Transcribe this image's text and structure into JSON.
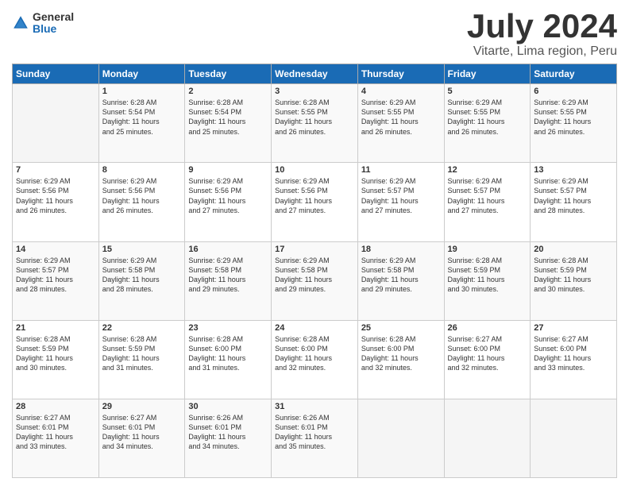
{
  "header": {
    "logo": {
      "line1": "General",
      "line2": "Blue"
    },
    "title": "July 2024",
    "subtitle": "Vitarte, Lima region, Peru"
  },
  "days_of_week": [
    "Sunday",
    "Monday",
    "Tuesday",
    "Wednesday",
    "Thursday",
    "Friday",
    "Saturday"
  ],
  "weeks": [
    [
      {
        "day": "",
        "info": ""
      },
      {
        "day": "1",
        "info": "Sunrise: 6:28 AM\nSunset: 5:54 PM\nDaylight: 11 hours\nand 25 minutes."
      },
      {
        "day": "2",
        "info": "Sunrise: 6:28 AM\nSunset: 5:54 PM\nDaylight: 11 hours\nand 25 minutes."
      },
      {
        "day": "3",
        "info": "Sunrise: 6:28 AM\nSunset: 5:55 PM\nDaylight: 11 hours\nand 26 minutes."
      },
      {
        "day": "4",
        "info": "Sunrise: 6:29 AM\nSunset: 5:55 PM\nDaylight: 11 hours\nand 26 minutes."
      },
      {
        "day": "5",
        "info": "Sunrise: 6:29 AM\nSunset: 5:55 PM\nDaylight: 11 hours\nand 26 minutes."
      },
      {
        "day": "6",
        "info": "Sunrise: 6:29 AM\nSunset: 5:55 PM\nDaylight: 11 hours\nand 26 minutes."
      }
    ],
    [
      {
        "day": "7",
        "info": "Sunrise: 6:29 AM\nSunset: 5:56 PM\nDaylight: 11 hours\nand 26 minutes."
      },
      {
        "day": "8",
        "info": "Sunrise: 6:29 AM\nSunset: 5:56 PM\nDaylight: 11 hours\nand 26 minutes."
      },
      {
        "day": "9",
        "info": "Sunrise: 6:29 AM\nSunset: 5:56 PM\nDaylight: 11 hours\nand 27 minutes."
      },
      {
        "day": "10",
        "info": "Sunrise: 6:29 AM\nSunset: 5:56 PM\nDaylight: 11 hours\nand 27 minutes."
      },
      {
        "day": "11",
        "info": "Sunrise: 6:29 AM\nSunset: 5:57 PM\nDaylight: 11 hours\nand 27 minutes."
      },
      {
        "day": "12",
        "info": "Sunrise: 6:29 AM\nSunset: 5:57 PM\nDaylight: 11 hours\nand 27 minutes."
      },
      {
        "day": "13",
        "info": "Sunrise: 6:29 AM\nSunset: 5:57 PM\nDaylight: 11 hours\nand 28 minutes."
      }
    ],
    [
      {
        "day": "14",
        "info": "Sunrise: 6:29 AM\nSunset: 5:57 PM\nDaylight: 11 hours\nand 28 minutes."
      },
      {
        "day": "15",
        "info": "Sunrise: 6:29 AM\nSunset: 5:58 PM\nDaylight: 11 hours\nand 28 minutes."
      },
      {
        "day": "16",
        "info": "Sunrise: 6:29 AM\nSunset: 5:58 PM\nDaylight: 11 hours\nand 29 minutes."
      },
      {
        "day": "17",
        "info": "Sunrise: 6:29 AM\nSunset: 5:58 PM\nDaylight: 11 hours\nand 29 minutes."
      },
      {
        "day": "18",
        "info": "Sunrise: 6:29 AM\nSunset: 5:58 PM\nDaylight: 11 hours\nand 29 minutes."
      },
      {
        "day": "19",
        "info": "Sunrise: 6:28 AM\nSunset: 5:59 PM\nDaylight: 11 hours\nand 30 minutes."
      },
      {
        "day": "20",
        "info": "Sunrise: 6:28 AM\nSunset: 5:59 PM\nDaylight: 11 hours\nand 30 minutes."
      }
    ],
    [
      {
        "day": "21",
        "info": "Sunrise: 6:28 AM\nSunset: 5:59 PM\nDaylight: 11 hours\nand 30 minutes."
      },
      {
        "day": "22",
        "info": "Sunrise: 6:28 AM\nSunset: 5:59 PM\nDaylight: 11 hours\nand 31 minutes."
      },
      {
        "day": "23",
        "info": "Sunrise: 6:28 AM\nSunset: 6:00 PM\nDaylight: 11 hours\nand 31 minutes."
      },
      {
        "day": "24",
        "info": "Sunrise: 6:28 AM\nSunset: 6:00 PM\nDaylight: 11 hours\nand 32 minutes."
      },
      {
        "day": "25",
        "info": "Sunrise: 6:28 AM\nSunset: 6:00 PM\nDaylight: 11 hours\nand 32 minutes."
      },
      {
        "day": "26",
        "info": "Sunrise: 6:27 AM\nSunset: 6:00 PM\nDaylight: 11 hours\nand 32 minutes."
      },
      {
        "day": "27",
        "info": "Sunrise: 6:27 AM\nSunset: 6:00 PM\nDaylight: 11 hours\nand 33 minutes."
      }
    ],
    [
      {
        "day": "28",
        "info": "Sunrise: 6:27 AM\nSunset: 6:01 PM\nDaylight: 11 hours\nand 33 minutes."
      },
      {
        "day": "29",
        "info": "Sunrise: 6:27 AM\nSunset: 6:01 PM\nDaylight: 11 hours\nand 34 minutes."
      },
      {
        "day": "30",
        "info": "Sunrise: 6:26 AM\nSunset: 6:01 PM\nDaylight: 11 hours\nand 34 minutes."
      },
      {
        "day": "31",
        "info": "Sunrise: 6:26 AM\nSunset: 6:01 PM\nDaylight: 11 hours\nand 35 minutes."
      },
      {
        "day": "",
        "info": ""
      },
      {
        "day": "",
        "info": ""
      },
      {
        "day": "",
        "info": ""
      }
    ]
  ]
}
